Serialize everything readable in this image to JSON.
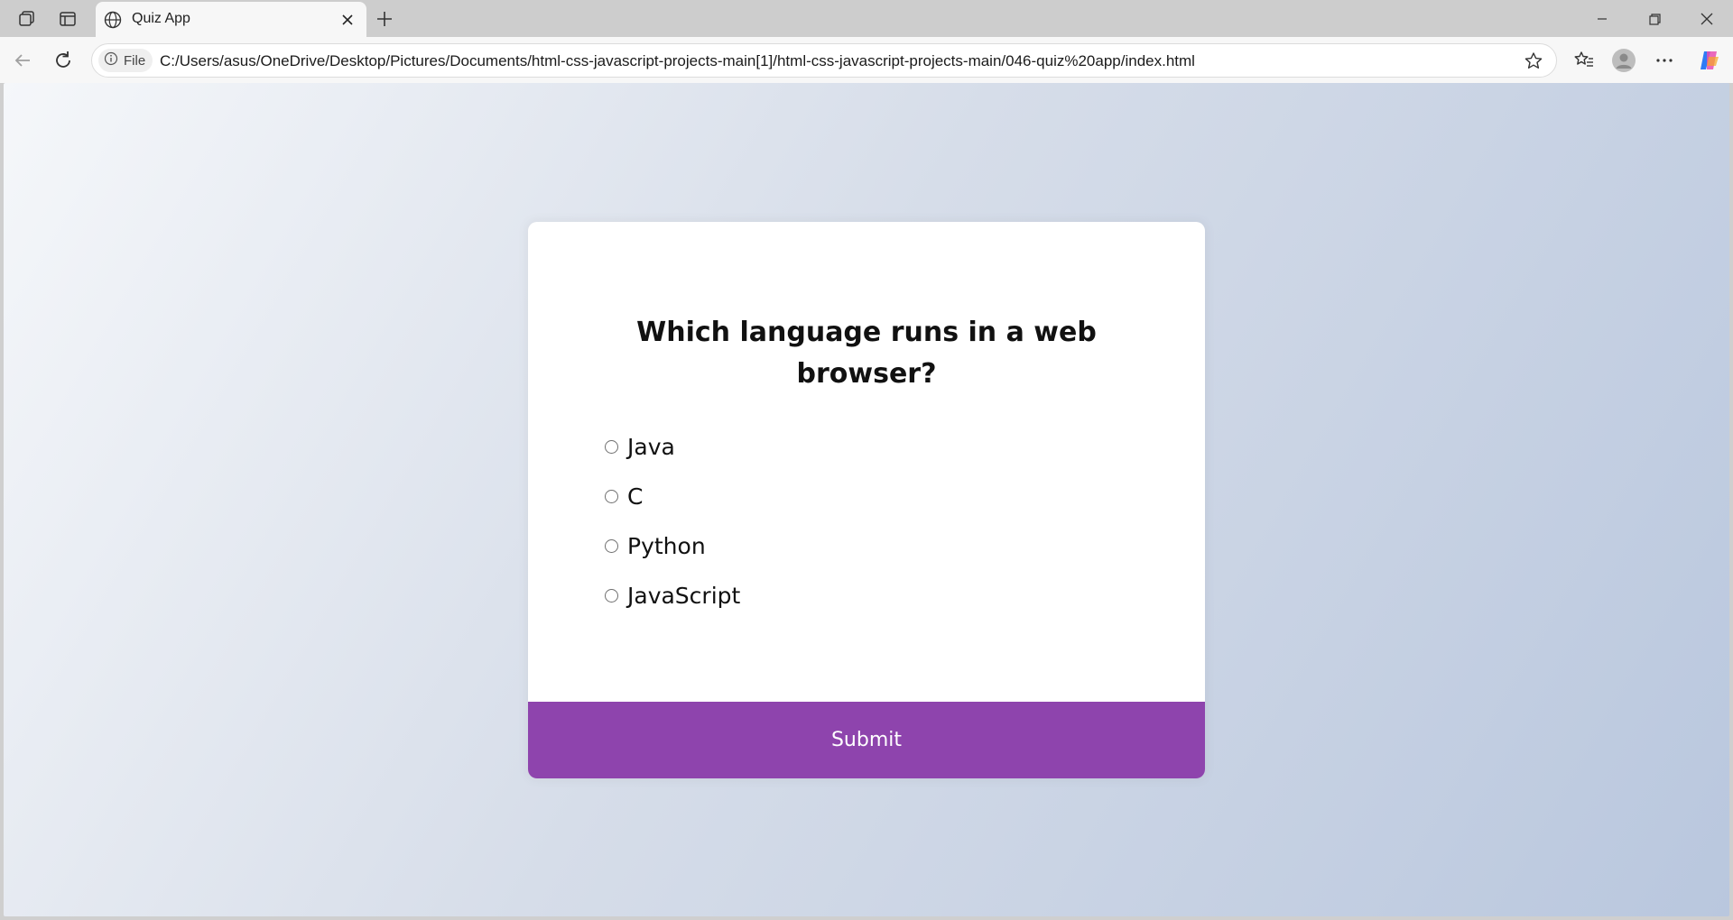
{
  "browser": {
    "tab": {
      "title": "Quiz App"
    },
    "address_bar": {
      "scheme_label": "File",
      "url": "C:/Users/asus/OneDrive/Desktop/Pictures/Documents/html-css-javascript-projects-main[1]/html-css-javascript-projects-main/046-quiz%20app/index.html"
    },
    "icons": {
      "workspaces": "workspaces-icon",
      "tab_actions": "vertical-tabs-icon",
      "tab_favicon": "globe-icon",
      "tab_close": "close-icon",
      "new_tab": "plus-icon",
      "minimize": "minimize-icon",
      "restore": "restore-icon",
      "close_window": "close-icon",
      "back": "back-arrow-icon",
      "refresh": "refresh-icon",
      "info": "info-icon",
      "favorite": "star-icon",
      "favorites": "favorites-icon",
      "profile": "profile-icon",
      "more": "more-icon",
      "copilot": "copilot-icon"
    }
  },
  "quiz": {
    "question": "Which language runs in a web browser?",
    "answers": [
      "Java",
      "C",
      "Python",
      "JavaScript"
    ],
    "selected": null,
    "submit_label": "Submit"
  },
  "colors": {
    "accent": "#8e44ad",
    "card": "#ffffff",
    "background_start": "#f5f7fa",
    "background_end": "#b9c7de"
  }
}
